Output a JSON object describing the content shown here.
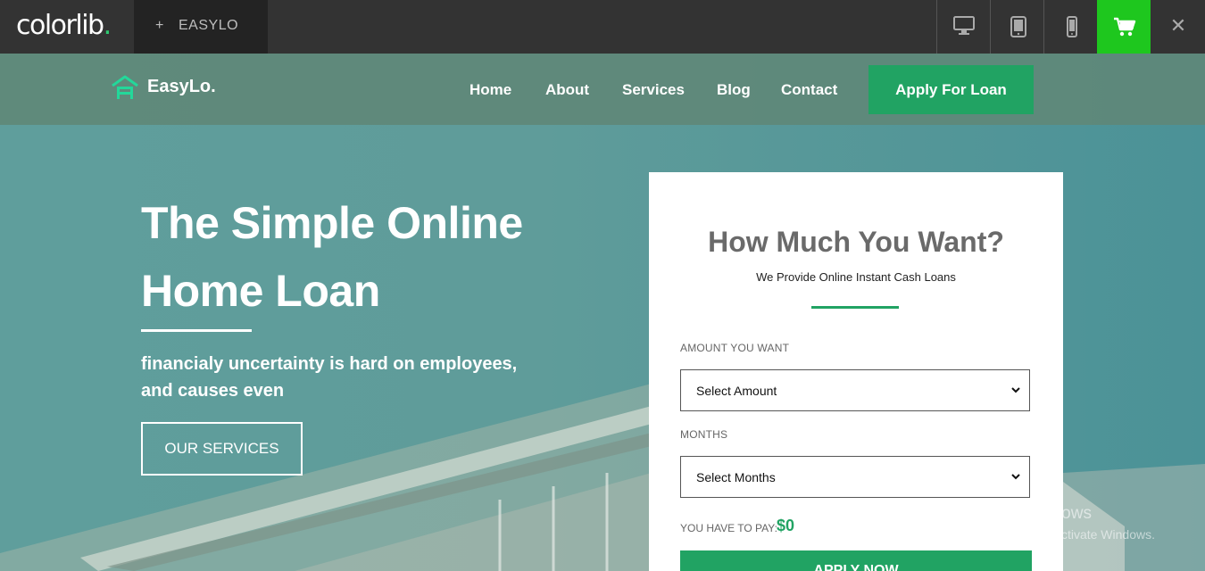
{
  "topbar": {
    "logo_text": "colorlib",
    "logo_dot": ".",
    "demo_plus": "+",
    "demo_name": "EASYLO",
    "icons": [
      "desktop-icon",
      "tablet-icon",
      "mobile-icon",
      "cart-icon",
      "close-icon"
    ],
    "close_glyph": "✕"
  },
  "nav": {
    "brand": "EasyLo.",
    "links": [
      "Home",
      "About",
      "Services",
      "Blog",
      "Contact"
    ],
    "cta": "Apply For Loan"
  },
  "hero": {
    "headline_line1": "The Simple Online",
    "headline_line2": "Home Loan",
    "subtext_line1": "financialy uncertainty is hard on employees,",
    "subtext_line2": "and causes even",
    "button": "OUR SERVICES"
  },
  "form": {
    "title": "How Much You Want?",
    "subtitle": "We Provide Online Instant Cash Loans",
    "amount_label": "AMOUNT YOU WANT",
    "amount_value": "Select Amount",
    "months_label": "MONTHS",
    "months_value": "Select Months",
    "pay_label": "YOU HAVE TO PAY:",
    "pay_value": "$0",
    "submit": "APPLY NOW"
  },
  "watermark": {
    "line1": "Activate Windows",
    "line2": "Go to Settings to activate Windows."
  },
  "colors": {
    "accent_green": "#21a363",
    "cart_green": "#1ec71e",
    "topbar": "#333333"
  }
}
